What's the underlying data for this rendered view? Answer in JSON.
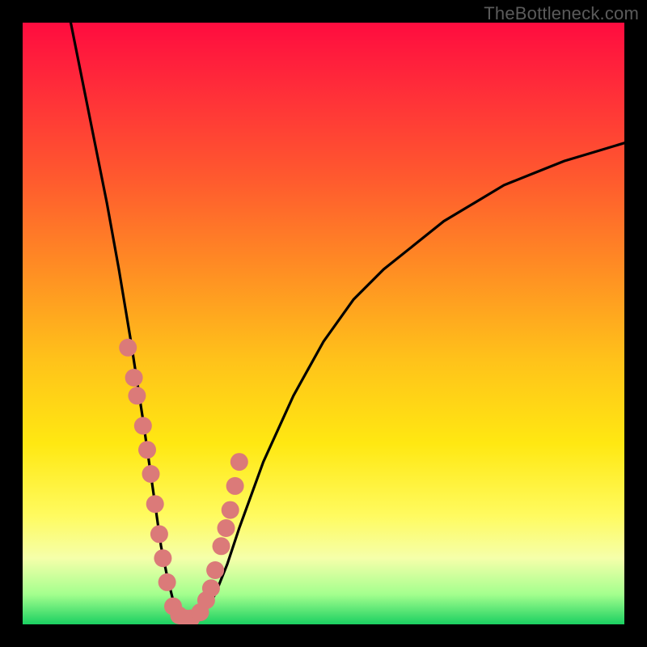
{
  "watermark": "TheBottleneck.com",
  "chart_data": {
    "type": "line",
    "title": "",
    "xlabel": "",
    "ylabel": "",
    "xlim": [
      0,
      100
    ],
    "ylim": [
      0,
      100
    ],
    "legend": false,
    "grid": false,
    "background_gradient": [
      "#ff0c3f",
      "#ff5a2e",
      "#ffc21a",
      "#fffb60",
      "#1bd061"
    ],
    "series": [
      {
        "name": "bottleneck-curve",
        "color": "#000000",
        "x": [
          8,
          10,
          12,
          14,
          16,
          18,
          20,
          22,
          23,
          24,
          25,
          26,
          27,
          28,
          30,
          32,
          34,
          36,
          40,
          45,
          50,
          55,
          60,
          65,
          70,
          75,
          80,
          85,
          90,
          95,
          100
        ],
        "values": [
          100,
          90,
          80,
          70,
          59,
          47,
          34,
          20,
          13,
          8,
          4,
          2,
          1,
          1,
          2,
          5,
          10,
          16,
          27,
          38,
          47,
          54,
          59,
          63,
          67,
          70,
          73,
          75,
          77,
          78.5,
          80
        ]
      },
      {
        "name": "highlight-dots",
        "color": "#db7a79",
        "type": "scatter",
        "x": [
          17.5,
          18.5,
          19.0,
          20.0,
          20.7,
          21.3,
          22.0,
          22.7,
          23.3,
          24.0,
          25.0,
          26.0,
          27.0,
          28.0,
          29.5,
          30.5,
          31.3,
          32.0,
          33.0,
          33.8,
          34.5,
          35.3,
          36.0
        ],
        "values": [
          46,
          41,
          38,
          33,
          29,
          25,
          20,
          15,
          11,
          7,
          3,
          1.5,
          1,
          1,
          2,
          4,
          6,
          9,
          13,
          16,
          19,
          23,
          27
        ]
      }
    ]
  }
}
